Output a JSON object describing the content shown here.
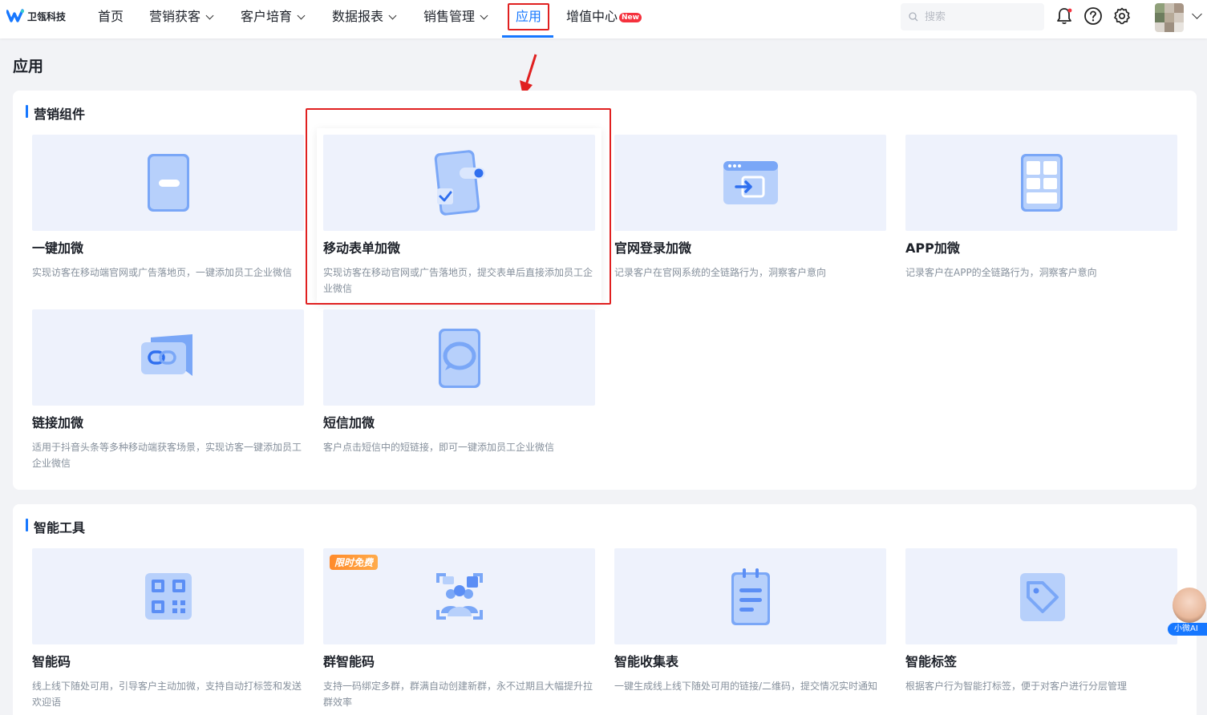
{
  "brand": {
    "name": "卫瓴科技"
  },
  "nav": {
    "items": [
      {
        "label": "首页"
      },
      {
        "label": "营销获客"
      },
      {
        "label": "客户培育"
      },
      {
        "label": "数据报表"
      },
      {
        "label": "销售管理"
      },
      {
        "label": "应用"
      },
      {
        "label": "增值中心"
      }
    ],
    "new_badge": "New",
    "active": "应用"
  },
  "search": {
    "placeholder": "搜索"
  },
  "page": {
    "title": "应用"
  },
  "sections": [
    {
      "title": "营销组件",
      "cards": [
        {
          "title": "一键加微",
          "desc": "实现访客在移动端官网或广告落地页，一键添加员工企业微信",
          "icon": "phone-button-icon"
        },
        {
          "title": "移动表单加微",
          "desc": "实现访客在移动官网或广告落地页，提交表单后直接添加员工企业微信",
          "icon": "phone-form-toggle-icon"
        },
        {
          "title": "官网登录加微",
          "desc": "记录客户在官网系统的全链路行为，洞察客户意向",
          "icon": "browser-login-icon"
        },
        {
          "title": "APP加微",
          "desc": "记录客户在APP的全链路行为，洞察客户意向",
          "icon": "app-grid-icon"
        },
        {
          "title": "链接加微",
          "desc": "适用于抖音头条等多种移动端获客场景，实现访客一键添加员工企业微信",
          "icon": "link-chat-icon"
        },
        {
          "title": "短信加微",
          "desc": "客户点击短信中的短链接，即可一键添加员工企业微信",
          "icon": "sms-bubble-icon"
        }
      ]
    },
    {
      "title": "智能工具",
      "cards": [
        {
          "title": "智能码",
          "desc": "线上线下随处可用，引导客户主动加微，支持自动打标签和发送欢迎语",
          "icon": "qr-code-icon"
        },
        {
          "title": "群智能码",
          "desc": "支持一码绑定多群，群满自动创建新群，永不过期且大幅提升拉群效率",
          "icon": "group-qr-icon",
          "badge": "限时免费"
        },
        {
          "title": "智能收集表",
          "desc": "一键生成线上线下随处可用的链接/二维码，提交情况实时通知",
          "icon": "clipboard-form-icon"
        },
        {
          "title": "智能标签",
          "desc": "根据客户行为智能打标签，便于对客户进行分层管理",
          "icon": "tag-icon"
        }
      ]
    }
  ],
  "ai_assistant": {
    "label": "小微AI"
  },
  "colors": {
    "accent": "#1677ff",
    "highlight": "#e02020",
    "card_bg": "#eef2fc"
  }
}
